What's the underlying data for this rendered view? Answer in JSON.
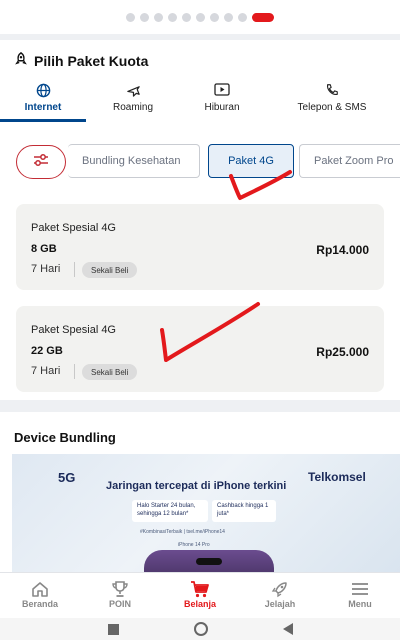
{
  "carousel": {
    "total_dots": 10,
    "active_index": 9
  },
  "section": {
    "title": "Pilih Paket Kuota",
    "icon": "rocket-icon"
  },
  "tabs": [
    {
      "label": "Internet",
      "icon": "globe-icon",
      "active": true
    },
    {
      "label": "Roaming",
      "icon": "plane-icon",
      "active": false
    },
    {
      "label": "Hiburan",
      "icon": "play-icon",
      "active": false
    },
    {
      "label": "Telepon & SMS",
      "icon": "phone-icon",
      "active": false
    }
  ],
  "filter": {
    "icon": "sliders-icon"
  },
  "chips": [
    {
      "label": "Bundling Kesehatan",
      "selected": false
    },
    {
      "label": "Paket 4G",
      "selected": true
    },
    {
      "label": "Paket Zoom Pro",
      "selected": false
    }
  ],
  "packages": [
    {
      "name": "Paket Spesial 4G",
      "quota": "8 GB",
      "price": "Rp14.000",
      "duration": "7 Hari",
      "badge": "Sekali Beli"
    },
    {
      "name": "Paket Spesial 4G",
      "quota": "22 GB",
      "price": "Rp25.000",
      "duration": "7 Hari",
      "badge": "Sekali Beli"
    }
  ],
  "device": {
    "title": "Device Bundling",
    "banner": {
      "tag_5g": "5G",
      "headline": "Jaringan tercepat di iPhone terkini",
      "brand": "Telkomsel",
      "offer1": "Halo Starter 24 bulan, sehingga 12 bulan*",
      "offer2": "Cashback hingga 1 juta*",
      "hashtag": "#KombinasiTerbaik | tsel.me/iPhone14",
      "model": "iPhone 14 Pro"
    }
  },
  "nav": [
    {
      "label": "Beranda",
      "icon": "home-icon",
      "active": false
    },
    {
      "label": "POIN",
      "icon": "trophy-icon",
      "active": false
    },
    {
      "label": "Belanja",
      "icon": "cart-icon",
      "active": true
    },
    {
      "label": "Jelajah",
      "icon": "rocket-icon",
      "active": false
    },
    {
      "label": "Menu",
      "icon": "menu-icon",
      "active": false
    }
  ],
  "colors": {
    "accent": "#e3191c",
    "primary": "#00468c",
    "annotation": "#e3191c"
  }
}
